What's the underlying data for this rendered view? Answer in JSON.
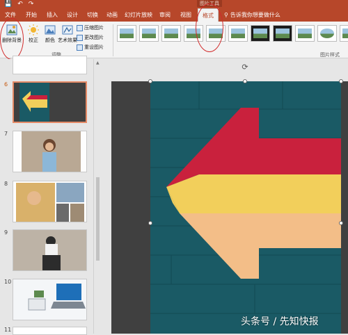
{
  "quick_access": {
    "save": "💾",
    "undo": "↶",
    "redo": "↷"
  },
  "context": {
    "label": "图片工具"
  },
  "tabs": [
    "文件",
    "开始",
    "插入",
    "设计",
    "切换",
    "动画",
    "幻灯片放映",
    "审阅",
    "视图",
    "格式"
  ],
  "search": {
    "placeholder": "告诉我你想要做什么"
  },
  "ribbon": {
    "remove_bg": "删除背景",
    "correct": "校正",
    "color": "颜色",
    "artistic": "艺术效果",
    "compress": "压缩图片",
    "change": "更改图片",
    "reset": "重设图片",
    "adjust_group": "调整",
    "styles_group": "图片样式"
  },
  "slides": {
    "numbers": [
      "6",
      "7",
      "8",
      "9",
      "10",
      "11"
    ]
  },
  "watermark": "头条号 / 先知快报",
  "colors": {
    "accent": "#b7472a",
    "photo_bg": "#1a5a65",
    "arrow_red": "#c9213d",
    "arrow_yellow": "#f2cf5b",
    "arrow_peach": "#f3be88"
  }
}
